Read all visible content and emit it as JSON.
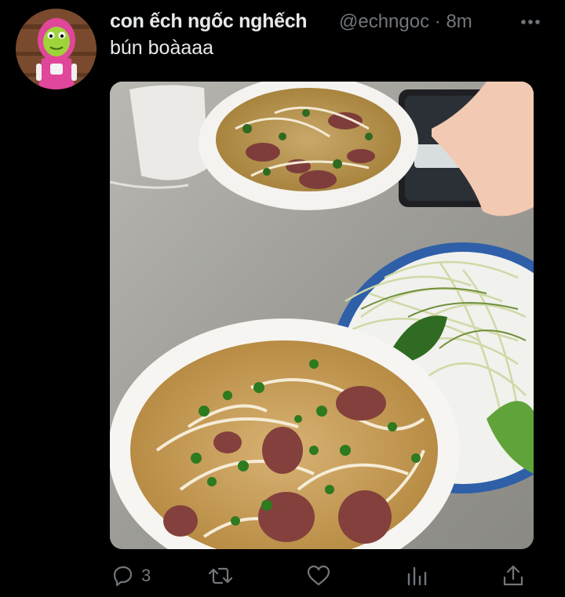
{
  "tweet": {
    "display_name": "con ếch ngốc nghếch",
    "handle": "@echngoc",
    "separator": "·",
    "time": "8m",
    "text": "bún boàaaa",
    "avatar_icon": "frog-avatar",
    "media_description_icon": "photo-two-bowls-of-noodle-soup"
  },
  "actions": {
    "reply_count": "3",
    "icons": [
      "reply-icon",
      "retweet-icon",
      "like-icon",
      "analytics-icon",
      "share-icon"
    ]
  },
  "colors": {
    "background": "#000000",
    "primary_text": "#e7e9ea",
    "secondary_text": "#71767b"
  }
}
